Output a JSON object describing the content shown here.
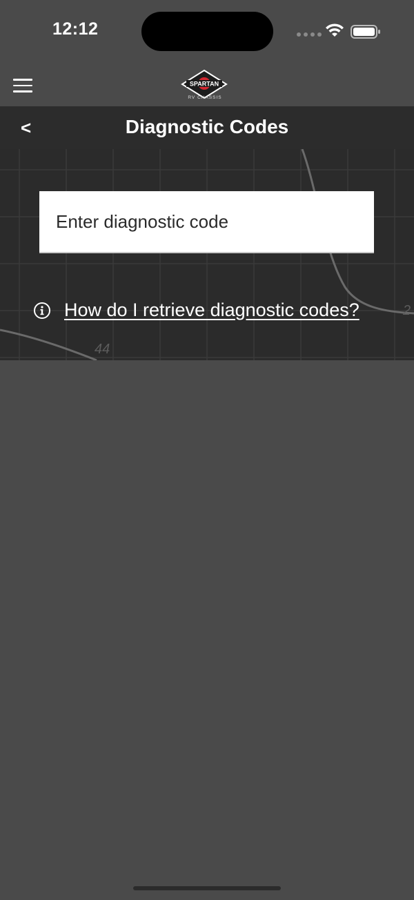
{
  "status_bar": {
    "time": "12:12"
  },
  "app_bar": {
    "logo_text": "SPARTAN",
    "logo_subtext": "RV CHASSIS",
    "brand_red": "#d22630"
  },
  "header": {
    "back_label": "<",
    "title": "Diagnostic Codes"
  },
  "form": {
    "code_placeholder": "Enter diagnostic code",
    "code_value": ""
  },
  "help": {
    "link_text": "How do I retrieve diagnostic codes?"
  },
  "background_chart_labels": {
    "left": "44",
    "right": "2"
  }
}
